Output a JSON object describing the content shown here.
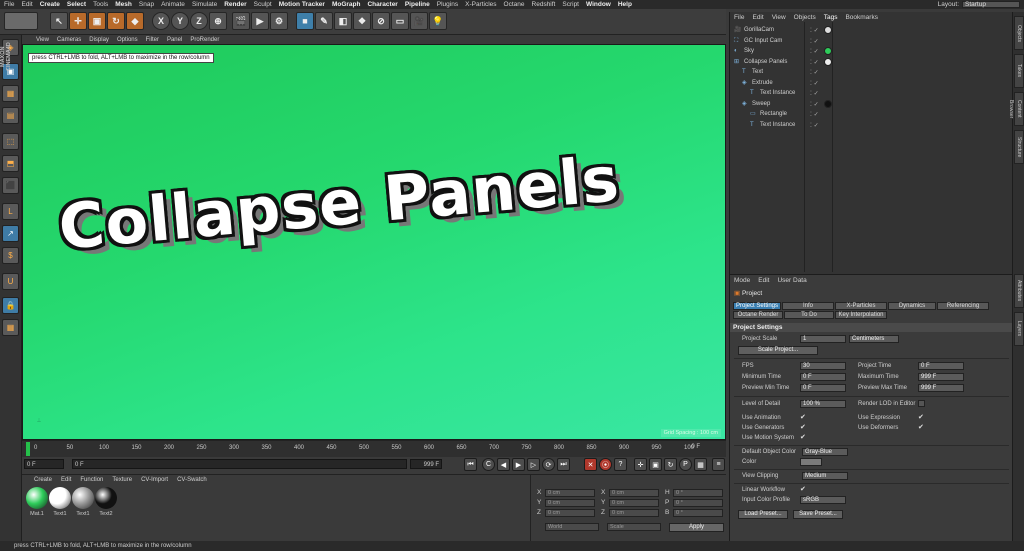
{
  "menubar": {
    "items": [
      "File",
      "Edit",
      "Create",
      "Select",
      "Tools",
      "Mesh",
      "Snap",
      "Animate",
      "Simulate",
      "Render",
      "Sculpt",
      "Motion Tracker",
      "MoGraph",
      "Character",
      "Pipeline",
      "Plugins",
      "X-Particles",
      "Octane",
      "Redshift",
      "Script",
      "Window",
      "Help"
    ],
    "layout_label": "Layout:",
    "layout_value": "Startup"
  },
  "toolbar": {
    "axis_x": "X",
    "axis_y": "Y",
    "axis_z": "Z"
  },
  "viewport": {
    "menu": [
      "View",
      "Cameras",
      "Display",
      "Options",
      "Filter",
      "Panel",
      "ProRender"
    ],
    "tooltip": "press CTRL+LMB to fold, ALT+LMB to maximize in the row/column",
    "title_text": "Collapse Panels",
    "grid_spacing": "Grid Spacing : 100 cm"
  },
  "timeline": {
    "ticks": [
      "0",
      "50",
      "100",
      "150",
      "200",
      "250",
      "300",
      "350",
      "400",
      "450",
      "500",
      "550",
      "600",
      "650",
      "700",
      "750",
      "800",
      "850",
      "900",
      "950",
      "100"
    ],
    "end_label": "0 F"
  },
  "transport": {
    "start_frame": "0 F",
    "current_frame": "0 F",
    "end_field": "999 F",
    "max_field": "999 F"
  },
  "materials": {
    "menu": [
      "Create",
      "Edit",
      "Function",
      "Texture",
      "CV-Import",
      "CV-Swatch"
    ],
    "items": [
      {
        "label": "Mat.1",
        "color": "#2ecc5a"
      },
      {
        "label": "Text1",
        "color": "#ffffff"
      },
      {
        "label": "Text1",
        "color": "#9a9a9a"
      },
      {
        "label": "Text2",
        "color": "#111111"
      }
    ]
  },
  "coordinates": {
    "rows": [
      {
        "axis": "X",
        "pos": "0 cm",
        "axis2": "X",
        "size": "0 cm",
        "axis3": "H",
        "rot": "0 °"
      },
      {
        "axis": "Y",
        "pos": "0 cm",
        "axis2": "Y",
        "size": "0 cm",
        "axis3": "P",
        "rot": "0 °"
      },
      {
        "axis": "Z",
        "pos": "0 cm",
        "axis2": "Z",
        "size": "0 cm",
        "axis3": "B",
        "rot": "0 °"
      }
    ],
    "mode_sel": "World",
    "scale_sel": "Scale",
    "apply_label": "Apply"
  },
  "status": {
    "text": "press CTRL+LMB to fold, ALT+LMB to maximize in the row/column"
  },
  "objects": {
    "menu": [
      "File",
      "Edit",
      "View",
      "Objects",
      "Tags",
      "Bookmarks"
    ],
    "rows": [
      {
        "name": "GorillaCam",
        "indent": 0
      },
      {
        "name": "GC Input Cam",
        "indent": 0
      },
      {
        "name": "Sky",
        "indent": 0
      },
      {
        "name": "Collapse Panels",
        "indent": 0
      },
      {
        "name": "Text",
        "indent": 1
      },
      {
        "name": "Extrude",
        "indent": 1
      },
      {
        "name": "Text Instance",
        "indent": 2
      },
      {
        "name": "Sweep",
        "indent": 1
      },
      {
        "name": "Rectangle",
        "indent": 2
      },
      {
        "name": "Text Instance",
        "indent": 2
      }
    ]
  },
  "attributes": {
    "menu": [
      "Mode",
      "Edit",
      "User Data"
    ],
    "header": "Project",
    "tabs_row1": [
      "Project Settings",
      "Info",
      "X-Particles",
      "Dynamics",
      "Referencing"
    ],
    "tabs_row2": [
      "Octane Render",
      "To Do",
      "Key Interpolation"
    ],
    "section": "Project Settings",
    "project_scale_label": "Project Scale",
    "project_scale_value": "1",
    "project_scale_unit": "Centimeters",
    "scale_project_btn": "Scale Project...",
    "fps_label": "FPS",
    "fps_value": "30",
    "project_time_label": "Project Time",
    "project_time_value": "0 F",
    "min_time_label": "Minimum Time",
    "min_time_value": "0 F",
    "max_time_label": "Maximum Time",
    "max_time_value": "999 F",
    "prev_min_label": "Preview Min Time",
    "prev_min_value": "0 F",
    "prev_max_label": "Preview Max Time",
    "prev_max_value": "999 F",
    "lod_label": "Level of Detail",
    "lod_value": "100 %",
    "render_lod_label": "Render LOD in Editor",
    "use_animation": "Use Animation",
    "use_expression": "Use Expression",
    "use_generators": "Use Generators",
    "use_deformers": "Use Deformers",
    "use_motion": "Use Motion System",
    "default_color_label": "Default Object Color",
    "default_color_value": "Gray-Blue",
    "color_label": "Color",
    "view_clipping_label": "View Clipping",
    "view_clipping_value": "Medium",
    "linear_workflow": "Linear Workflow",
    "input_color_label": "Input Color Profile",
    "input_color_value": "sRGB",
    "load_preset": "Load Preset...",
    "save_preset": "Save Preset..."
  },
  "right_tabs": [
    "Objects",
    "Takes",
    "Content Browser",
    "Structure",
    "Attributes",
    "Layers"
  ]
}
